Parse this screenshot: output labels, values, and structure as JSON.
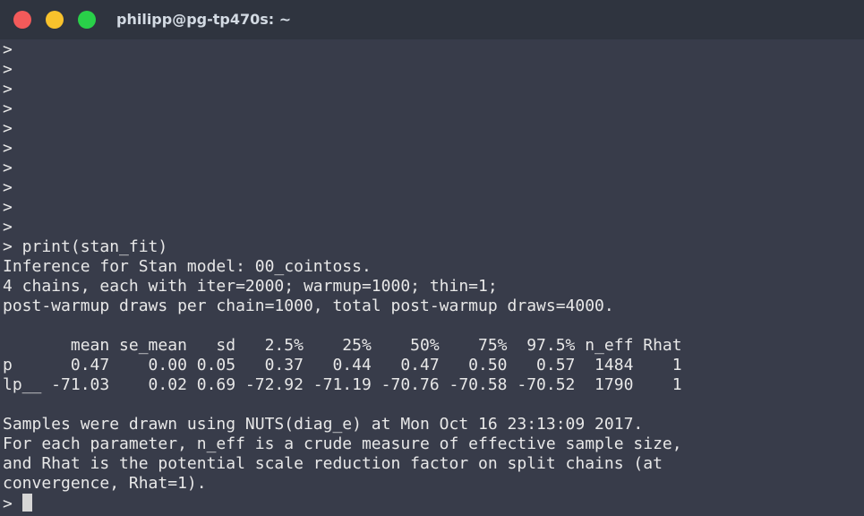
{
  "window": {
    "title": "philipp@pg-tp470s: ~"
  },
  "terminal": {
    "prompt_symbol": ">",
    "empty_prompts": [
      ">",
      ">",
      ">",
      ">",
      ">",
      ">",
      ">",
      ">",
      ">",
      ">"
    ],
    "command_line": "> print(stan_fit)",
    "output_header": [
      "Inference for Stan model: 00_cointoss.",
      "4 chains, each with iter=2000; warmup=1000; thin=1;",
      "post-warmup draws per chain=1000, total post-warmup draws=4000."
    ],
    "table": {
      "header": "       mean se_mean   sd   2.5%    25%    50%    75%  97.5% n_eff Rhat",
      "rows": [
        "p      0.47    0.00 0.05   0.37   0.44   0.47   0.50   0.57  1484    1",
        "lp__ -71.03    0.02 0.69 -72.92 -71.19 -70.76 -70.58 -70.52  1790    1"
      ]
    },
    "footer": [
      "Samples were drawn using NUTS(diag_e) at Mon Oct 16 23:13:09 2017.",
      "For each parameter, n_eff is a crude measure of effective sample size,",
      "and Rhat is the potential scale reduction factor on split chains (at",
      "convergence, Rhat=1)."
    ],
    "final_prompt": "> "
  }
}
